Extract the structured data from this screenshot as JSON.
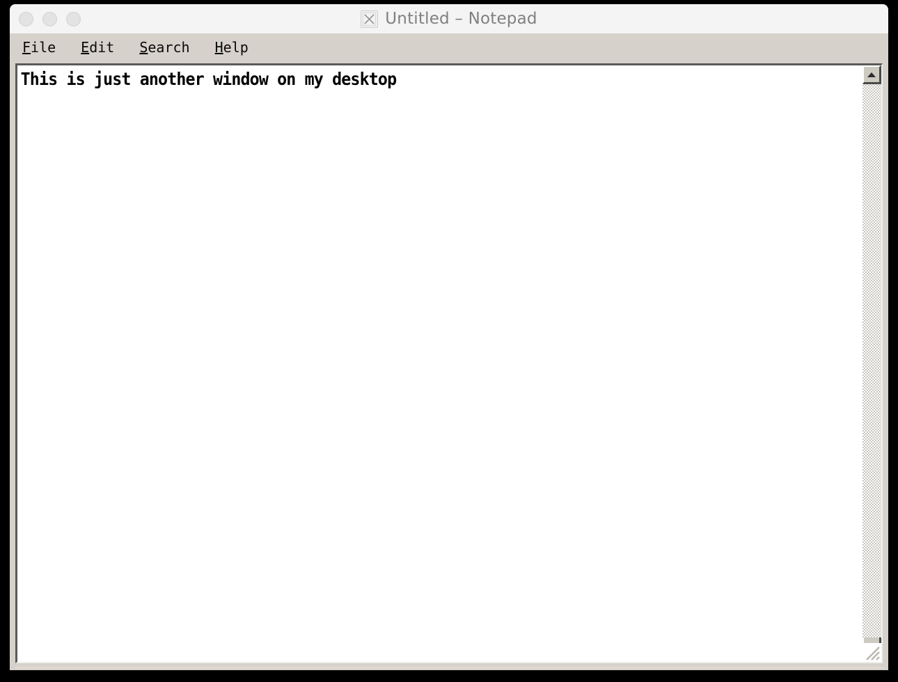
{
  "desktop": {
    "background_color": "#000000"
  },
  "window": {
    "title": "Untitled – Notepad",
    "app_icon": "x11-x-icon",
    "titlebar_color": "#f4f4f4",
    "menubar_color": "#d6d2cb",
    "client_color": "#ffffff",
    "controls": [
      {
        "name": "close-button",
        "label": "Close",
        "color": "#e3e3e3"
      },
      {
        "name": "minimize-button",
        "label": "Minimize",
        "color": "#e3e3e3"
      },
      {
        "name": "maximize-button",
        "label": "Maximize",
        "color": "#e3e3e3"
      }
    ]
  },
  "menubar": {
    "items": [
      {
        "accel": "F",
        "rest": "ile",
        "label": "File"
      },
      {
        "accel": "E",
        "rest": "dit",
        "label": "Edit"
      },
      {
        "accel": "S",
        "rest": "earch",
        "label": "Search"
      },
      {
        "accel": "H",
        "rest": "elp",
        "label": "Help"
      }
    ]
  },
  "document": {
    "content": "This is just another window on my desktop",
    "text_color": "#000000",
    "background_color": "#ffffff"
  },
  "scrollbar": {
    "orientation": "vertical",
    "up_arrow_icon": "triangle-up-icon",
    "trough_pattern": "checkerboard-dither",
    "thumb_visible": false,
    "position_percent": 0
  },
  "resize_grip": {
    "icon": "resize-grip-icon",
    "label": "Resize window"
  }
}
